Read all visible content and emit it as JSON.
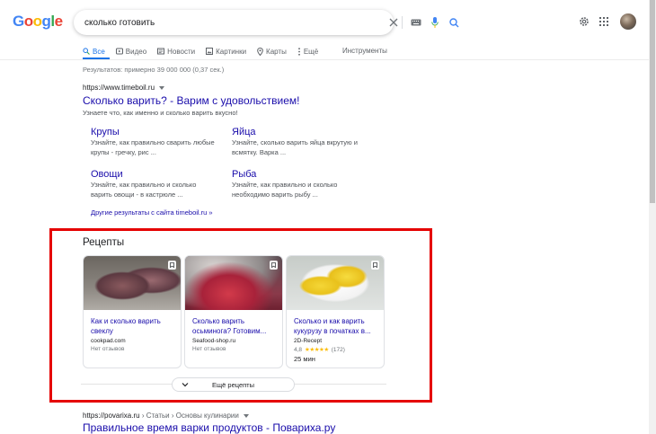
{
  "header": {
    "logo_text": "Google",
    "search_query": "сколько готовить"
  },
  "tabs": [
    {
      "label": "Все",
      "icon": "search-icon",
      "active": true
    },
    {
      "label": "Видео",
      "icon": "video-icon"
    },
    {
      "label": "Новости",
      "icon": "news-icon"
    },
    {
      "label": "Картинки",
      "icon": "image-icon"
    },
    {
      "label": "Карты",
      "icon": "map-pin-icon"
    },
    {
      "label": "Ещё",
      "icon": "more-vert-icon"
    }
  ],
  "tools_label": "Инструменты",
  "result_stats": "Результатов: примерно 39 000 000 (0,37 сек.)",
  "result1": {
    "url": "https://www.timeboil.ru",
    "title": "Сколько варить? - Варим с удовольствием!",
    "snippet": "Узнаете что, как именно и сколько варить вкусно!",
    "sitelinks": [
      {
        "title": "Крупы",
        "snippet": "Узнайте, как правильно сварить любые крупы - гречку, рис ..."
      },
      {
        "title": "Яйца",
        "snippet": "Узнайте, сколько варить яйца вкрутую и всмятку. Варка ..."
      },
      {
        "title": "Овощи",
        "snippet": "Узнайте, как правильно и сколько варить овощи - в кастрюле ..."
      },
      {
        "title": "Рыба",
        "snippet": "Узнайте, как правильно и сколько необходимо варить рыбу ..."
      }
    ],
    "more_link": "Другие результаты с сайта timeboil.ru »"
  },
  "recipes": {
    "heading": "Рецепты",
    "cards": [
      {
        "title": "Как и сколько варить свеклу",
        "source": "cookpad.com",
        "reviews": "Нет отзывов"
      },
      {
        "title": "Сколько варить осьминога? Готовим...",
        "source": "Seafood-shop.ru",
        "reviews": "Нет отзывов"
      },
      {
        "title": "Сколько и как варить кукурузу в початках в...",
        "source": "2D-Recept",
        "rating": "4,8",
        "stars": "★★★★★",
        "rating_count": "(172)",
        "time": "25 мин"
      }
    ],
    "more_button": "Ещё рецепты"
  },
  "result2": {
    "url": "https://povarixa.ru",
    "breadcrumb": " › Статьи › Основы кулинарии",
    "title": "Правильное время варки продуктов - Повариха.ру"
  },
  "colors": {
    "link": "#1a0dab",
    "accent": "#1a73e8",
    "highlight_frame": "#e50000"
  }
}
